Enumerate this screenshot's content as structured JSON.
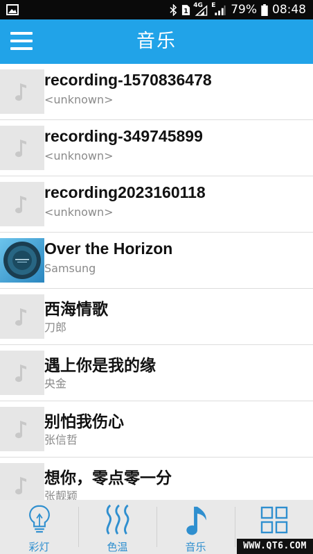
{
  "status_bar": {
    "network_type": "4G",
    "sim_slot": "1",
    "data_indicator": "E",
    "battery_percent": "79%",
    "time": "08:48",
    "icons": [
      "image-icon",
      "bluetooth-icon",
      "sim-icon",
      "signal-icon",
      "battery-icon"
    ]
  },
  "app_bar": {
    "title": "音乐",
    "menu_icon": "hamburger-menu-icon"
  },
  "tracks": [
    {
      "title": "recording-1570836478",
      "artist": "<unknown>",
      "art": "music-note-icon"
    },
    {
      "title": "recording-349745899",
      "artist": "<unknown>",
      "art": "music-note-icon"
    },
    {
      "title": "recording2023160118",
      "artist": "<unknown>",
      "art": "music-note-icon"
    },
    {
      "title": "Over the Horizon",
      "artist": "Samsung",
      "art": "album-cover"
    },
    {
      "title": "西海情歌",
      "artist": "刀郎",
      "art": "music-note-icon"
    },
    {
      "title": "遇上你是我的缘",
      "artist": "央金",
      "art": "music-note-icon"
    },
    {
      "title": "别怕我伤心",
      "artist": "张信哲",
      "art": "music-note-icon"
    },
    {
      "title": "想你，零点零一分",
      "artist": "张靓颖",
      "art": "music-note-icon"
    }
  ],
  "bottom_nav": [
    {
      "label": "彩灯",
      "icon": "bulb-icon"
    },
    {
      "label": "色温",
      "icon": "heat-waves-icon"
    },
    {
      "label": "音乐",
      "icon": "music-note-icon"
    },
    {
      "label": "",
      "icon": "grid-icon"
    }
  ],
  "watermark": "WWW.QT6.COM",
  "colors": {
    "app_bar": "#21a3e8",
    "nav_accent": "#2f8fcf",
    "status_bar": "#0a0a0a",
    "nav_background": "#e9e9e9"
  }
}
